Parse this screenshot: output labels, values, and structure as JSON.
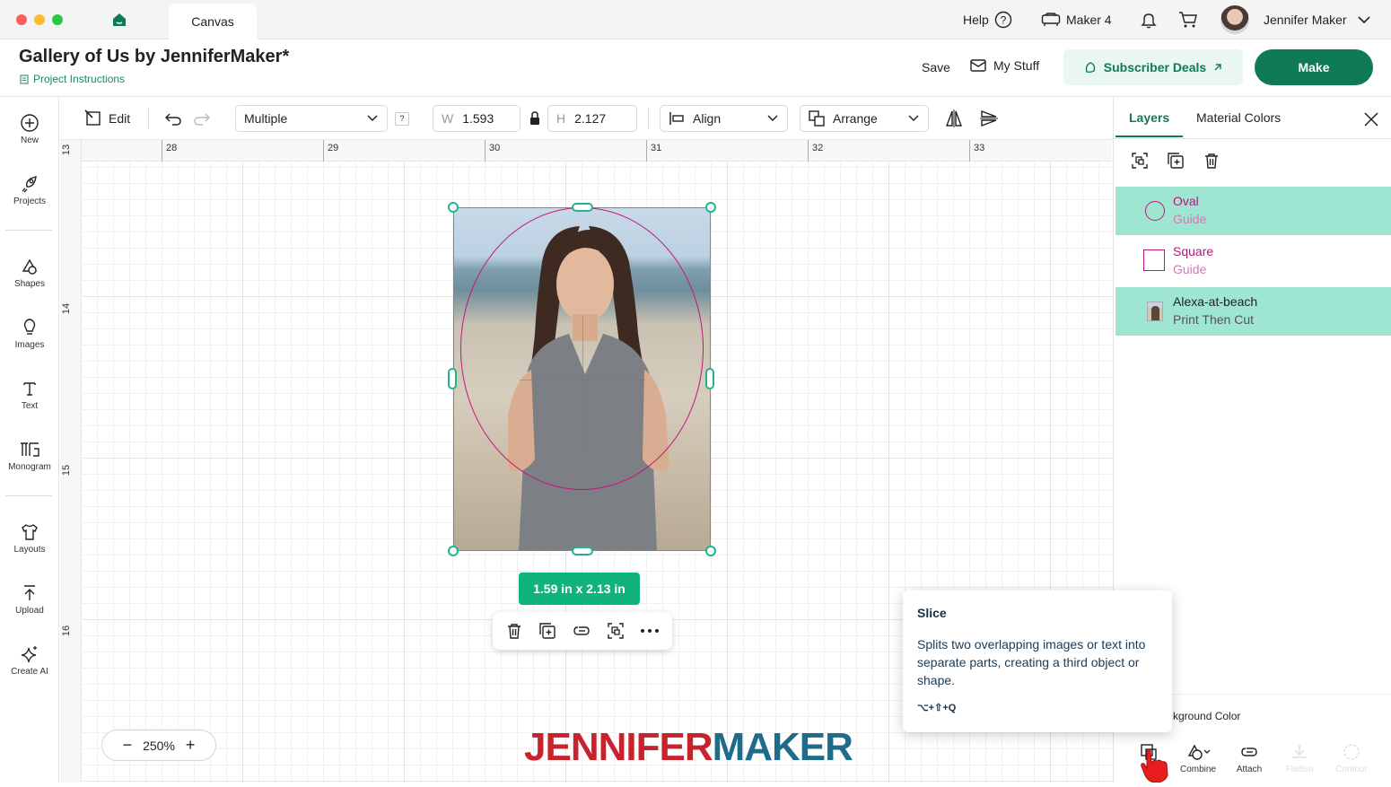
{
  "titlebar": {
    "tab": "Canvas",
    "help": "Help",
    "machine": "Maker 4",
    "user": "Jennifer Maker"
  },
  "header": {
    "title": "Gallery of Us by JenniferMaker*",
    "instructions": "Project Instructions",
    "save": "Save",
    "my_stuff": "My Stuff",
    "subscriber_deals": "Subscriber Deals",
    "make": "Make"
  },
  "sidebar": {
    "items": [
      {
        "label": "New",
        "icon": "plus-circle-icon"
      },
      {
        "label": "Projects",
        "icon": "rocket-icon"
      },
      {
        "label": "Shapes",
        "icon": "shapes-icon"
      },
      {
        "label": "Images",
        "icon": "lightbulb-icon"
      },
      {
        "label": "Text",
        "icon": "text-icon"
      },
      {
        "label": "Monogram",
        "icon": "monogram-icon"
      },
      {
        "label": "Layouts",
        "icon": "shirt-icon"
      },
      {
        "label": "Upload",
        "icon": "upload-icon"
      },
      {
        "label": "Create AI",
        "icon": "sparkle-icon"
      }
    ]
  },
  "toolbar": {
    "edit": "Edit",
    "operation": "Multiple",
    "help_badge": "?",
    "width_label": "W",
    "width_value": "1.593",
    "height_label": "H",
    "height_value": "2.127",
    "align": "Align",
    "arrange": "Arrange"
  },
  "rulers": {
    "top": [
      "28",
      "29",
      "30",
      "31",
      "32",
      "33"
    ],
    "left": [
      "13",
      "14",
      "15",
      "16"
    ]
  },
  "canvas": {
    "size_badge": "1.59  in x 2.13  in",
    "zoom": "250%"
  },
  "logo": {
    "part1": "JENNIFER",
    "part2": "MAKER",
    "color1": "#c8232c",
    "color2": "#1f6b8a"
  },
  "panel": {
    "tabs": [
      "Layers",
      "Material Colors"
    ],
    "layers": [
      {
        "name": "Oval",
        "sub": "Guide",
        "selected": true
      },
      {
        "name": "Square",
        "sub": "Guide",
        "selected": false
      },
      {
        "name": "Alexa-at-beach",
        "sub": "Print Then Cut",
        "selected": true
      }
    ],
    "background_color": "kground Color",
    "bottom_tools": [
      "Combine",
      "Attach",
      "Flatten",
      "Contour"
    ]
  },
  "tooltip": {
    "title": "Slice",
    "body": "Splits two overlapping images or text into separate parts, creating a third object or shape.",
    "shortcut": "⌥+⇧+Q"
  },
  "colors": {
    "accent": "#0f7b55",
    "selection": "#20b58a",
    "layer_highlight": "#9ee6d2",
    "guide_pink": "#c4167e"
  }
}
